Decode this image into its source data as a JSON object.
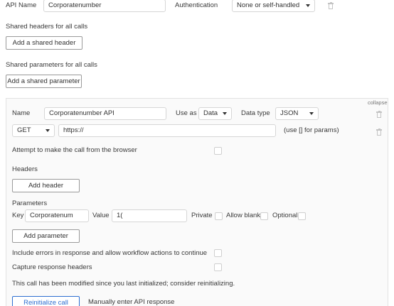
{
  "top": {
    "api_name_label": "API Name",
    "api_name_value": "Corporatenumber",
    "auth_label": "Authentication",
    "auth_value": "None or self-handled"
  },
  "shared_headers": {
    "title": "Shared headers for all calls",
    "button": "Add a shared header"
  },
  "shared_params": {
    "title": "Shared parameters for all calls",
    "button": "Add a shared parameter"
  },
  "call": {
    "collapse": "collapse",
    "name_label": "Name",
    "name_value": "Corporatenumber API",
    "use_as_label": "Use as",
    "use_as_value": "Data",
    "data_type_label": "Data type",
    "data_type_value": "JSON",
    "method_value": "GET",
    "url_value": "https://",
    "url_hint": "(use [] for params)",
    "browser_label": "Attempt to make the call from the browser",
    "headers_title": "Headers",
    "add_header": "Add header",
    "params_title": "Parameters",
    "param_key_label": "Key",
    "param_key_value": "Corporatenum",
    "param_value_label": "Value",
    "param_value_value": "1(",
    "private_label": "Private",
    "allow_blank_label": "Allow blank",
    "optional_label": "Optional",
    "add_parameter": "Add parameter",
    "include_errors_label": "Include errors in response and allow workflow actions to continue",
    "capture_headers_label": "Capture response headers",
    "modified_notice": "This call has been modified since you last initialized; consider reinitializing.",
    "reinitialize": "Reinitialize call",
    "manual": "Manually enter API response"
  }
}
